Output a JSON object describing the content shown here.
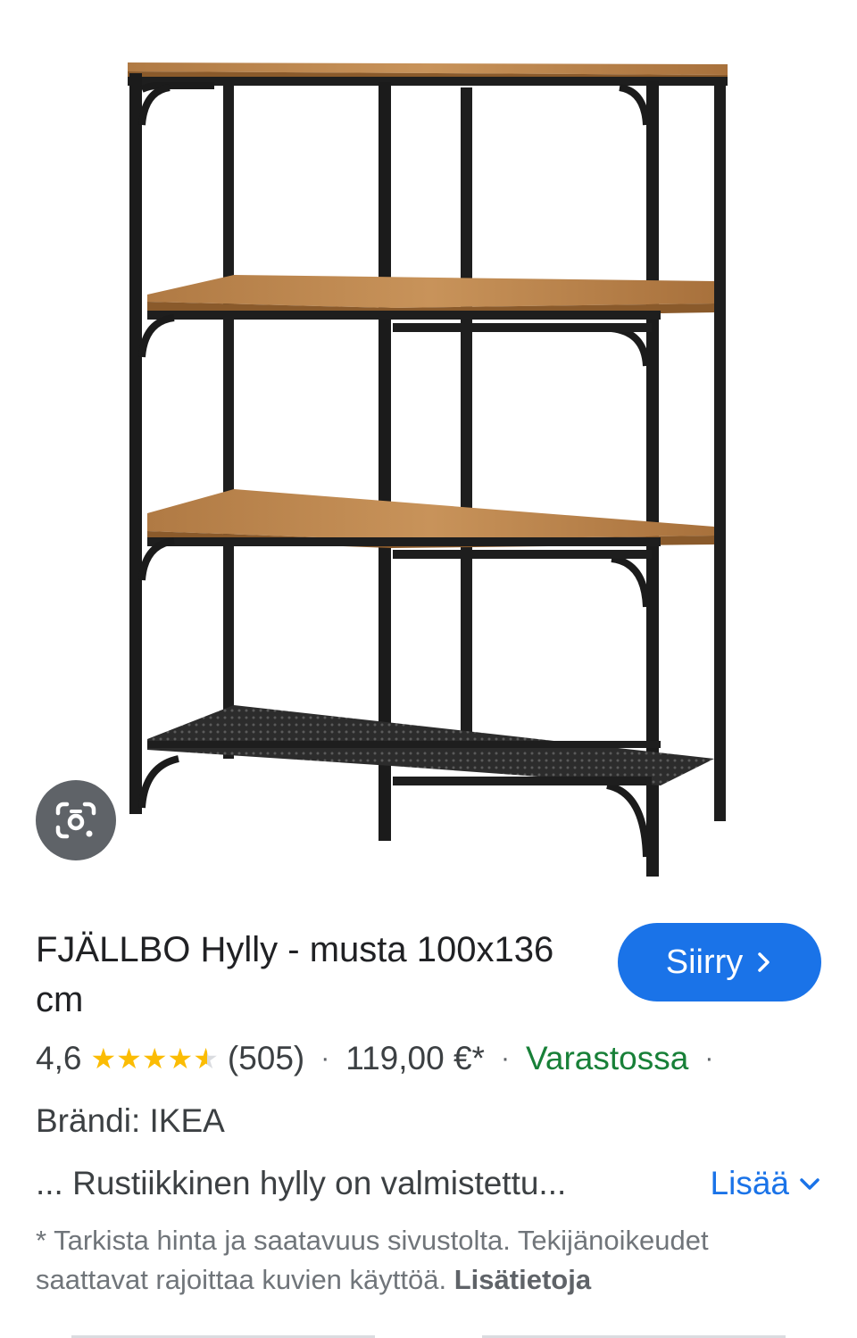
{
  "product": {
    "image_alt": "FJÄLLBO Hylly - musta 100x136 cm",
    "title": "FJÄLLBO Hylly - musta 100x136 cm",
    "go_button_label": "Siirry",
    "rating_value": "4,6",
    "rating_stars": 4.6,
    "review_count": "(505)",
    "price": "119,00 €*",
    "availability": "Varastossa",
    "brand": "Brändi: IKEA",
    "description": "... Rustiikkinen hylly on valmistettu...",
    "more_label": "Lisää",
    "note_text": "* Tarkista hinta ja saatavuus sivustolta. Tekijänoikeudet saattavat rajoittaa kuvien käyttöä.",
    "note_link": "Lisätietoja"
  },
  "colors": {
    "accent_blue": "#1a73e8",
    "star_yellow": "#fbbc04",
    "stock_green": "#188038",
    "lens_button": "#5f6368"
  },
  "icons": {
    "lens": "google-lens-icon",
    "chevron_right": "chevron-right-icon",
    "chevron_down": "chevron-down-icon"
  }
}
